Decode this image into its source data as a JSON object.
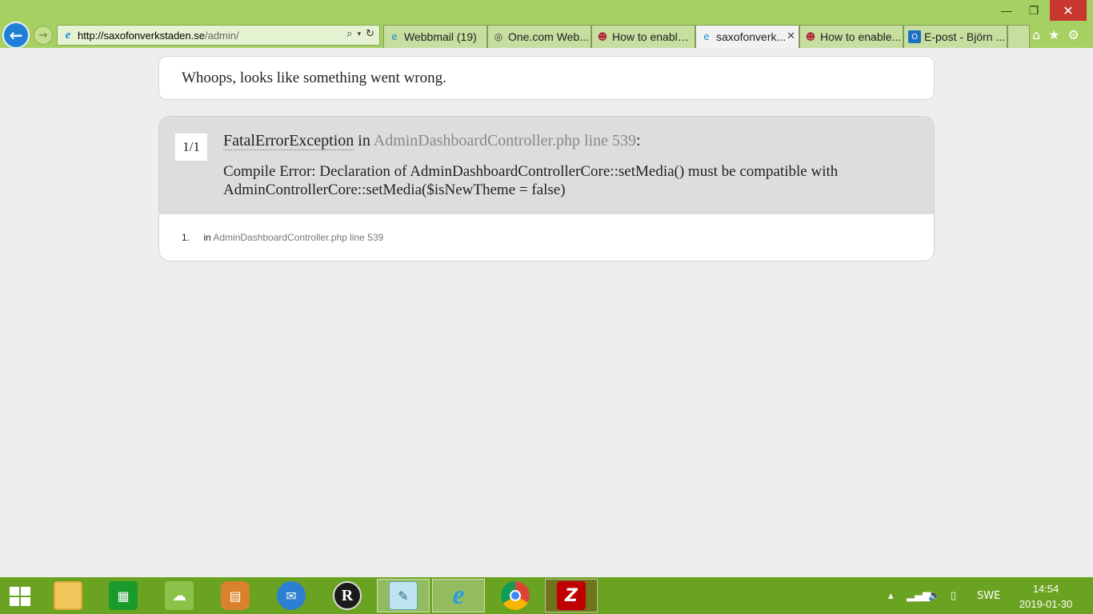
{
  "browser": {
    "address_host": "http://saxofonverkstaden.se",
    "address_path": "/admin/",
    "tabs": [
      {
        "label": "Webbmail (19)",
        "icon": "ie-icon",
        "active": false
      },
      {
        "label": "One.com Web...",
        "icon": "onecom-icon",
        "active": false
      },
      {
        "label": "How to enable ...",
        "icon": "prestashop-icon",
        "active": false
      },
      {
        "label": "saxofonverk...",
        "icon": "ie-icon",
        "active": true
      },
      {
        "label": "How to enable...",
        "icon": "prestashop-icon",
        "active": false
      },
      {
        "label": "E-post - Björn ...",
        "icon": "outlook-icon",
        "active": false
      }
    ]
  },
  "page": {
    "headline": "Whoops, looks like something went wrong.",
    "exception": {
      "count": "1/1",
      "class_name": "FatalErrorException",
      "in_word": "in",
      "location": "AdminDashboardController.php line 539",
      "colon": ":",
      "message": "Compile Error: Declaration of AdminDashboardControllerCore::setMedia() must be compatible with AdminControllerCore::setMedia($isNewTheme = false)"
    },
    "trace": [
      {
        "number": "1.",
        "in_word": "in",
        "location": "AdminDashboardController.php line 539"
      }
    ]
  },
  "taskbar": {
    "language": "SWE",
    "time": "14:54",
    "date": "2019-01-30",
    "apps": [
      "file-explorer-icon",
      "store-icon",
      "seafile-icon",
      "ibooks-icon",
      "thunderbird-icon",
      "reaper-icon",
      "notepad-icon",
      "internet-explorer-icon",
      "chrome-icon",
      "filezilla-icon"
    ]
  },
  "colors": {
    "chrome_bg": "#a6d162",
    "taskbar_bg": "#6aa321",
    "page_bg": "#eeeeee",
    "exception_header_bg": "#dddddd"
  }
}
